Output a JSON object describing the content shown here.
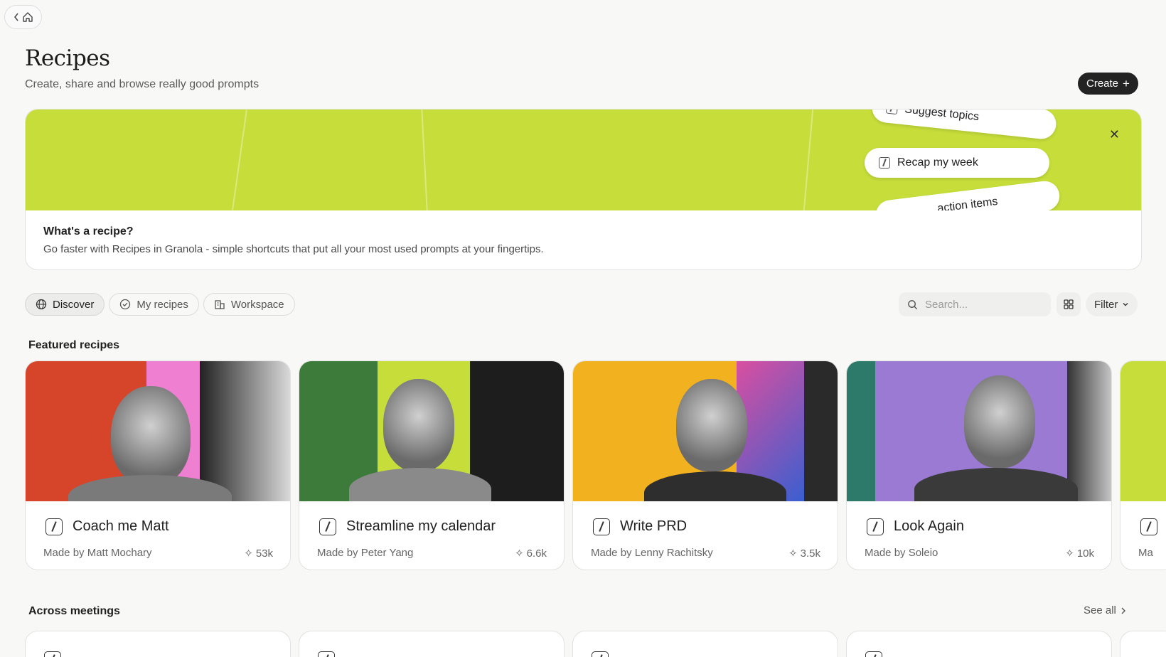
{
  "nav": {
    "back_icon": "chevron-left-icon",
    "home_icon": "home-icon"
  },
  "header": {
    "title": "Recipes",
    "subtitle": "Create, share and browse really good prompts",
    "create_label": "Create"
  },
  "banner": {
    "chips": [
      "Suggest topics",
      "Recap my week",
      "action items"
    ],
    "heading": "What's a recipe?",
    "text": "Go faster with Recipes in Granola - simple shortcuts that put all your most used prompts at your fingertips.",
    "accent_color": "#c6dd3a"
  },
  "tabs": [
    {
      "label": "Discover",
      "icon": "globe-icon",
      "active": true
    },
    {
      "label": "My recipes",
      "icon": "check-circle-icon",
      "active": false
    },
    {
      "label": "Workspace",
      "icon": "building-icon",
      "active": false
    }
  ],
  "search": {
    "placeholder": "Search..."
  },
  "filter": {
    "label": "Filter"
  },
  "featured": {
    "title": "Featured recipes",
    "cards": [
      {
        "title": "Coach me Matt",
        "author": "Made by Matt Mochary",
        "count": "53k",
        "colors": [
          "#d6452a",
          "#ef7fd0",
          "#222222"
        ]
      },
      {
        "title": "Streamline my calendar",
        "author": "Made by Peter Yang",
        "count": "6.6k",
        "colors": [
          "#3d7b3a",
          "#c6dd3a",
          "#1d1d1d"
        ]
      },
      {
        "title": "Write PRD",
        "author": "Made by Lenny Rachitsky",
        "count": "3.5k",
        "colors": [
          "#f2b11e",
          "#d94fa0",
          "#2a2a2a"
        ]
      },
      {
        "title": "Look Again",
        "author": "Made by Soleio",
        "count": "10k",
        "colors": [
          "#2d7a6b",
          "#9b7ad4",
          "#333333"
        ]
      },
      {
        "title": "",
        "author": "Ma",
        "count": "",
        "colors": [
          "#c6dd3a",
          "#c6dd3a",
          "#c6dd3a"
        ]
      }
    ]
  },
  "across": {
    "title": "Across meetings",
    "see_all": "See all"
  }
}
